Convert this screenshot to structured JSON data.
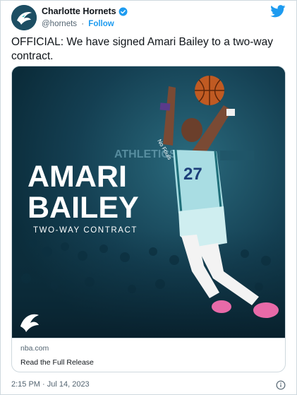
{
  "author": {
    "display_name": "Charlotte Hornets",
    "handle": "@hornets",
    "separator": "·",
    "follow_label": "Follow"
  },
  "tweet": {
    "text": "OFFICIAL: We have signed Amari Bailey to a two-way contract.",
    "timestamp": "2:15 PM · Jul 14, 2023"
  },
  "media": {
    "headline_first": "AMARI",
    "headline_last": "BAILEY",
    "subheadline": "TWO-WAY CONTRACT",
    "banner_text": "ATHLETICS",
    "jersey_number": "27",
    "wristband_text": "No Fouls"
  },
  "link_card": {
    "domain": "nba.com",
    "title": "Read the Full Release"
  },
  "colors": {
    "accent_blue": "#1d9bf0",
    "card_background": "#10394a",
    "teal": "#27c2c7"
  },
  "icons": [
    "hornets-logo-icon",
    "verified-icon",
    "twitter-bird-icon",
    "info-icon"
  ]
}
